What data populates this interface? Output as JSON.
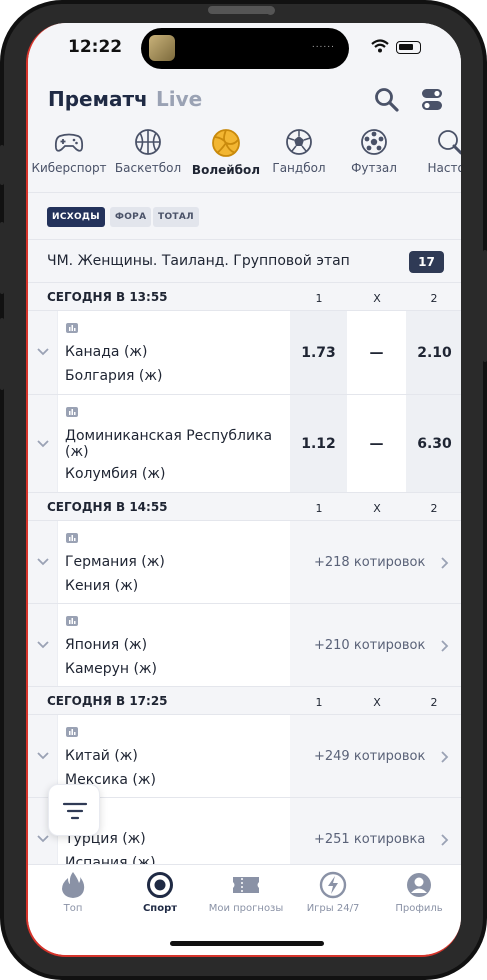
{
  "status_bar": {
    "time": "12:22",
    "island_dots": "......"
  },
  "header": {
    "tab_prematch": "Прематч",
    "tab_live": "Live"
  },
  "sports": [
    {
      "label": "Киберспорт",
      "icon": "gamepad-icon"
    },
    {
      "label": "Баскетбол",
      "icon": "basketball-icon"
    },
    {
      "label": "Волейбол",
      "icon": "volleyball-icon",
      "active": true
    },
    {
      "label": "Гандбол",
      "icon": "handball-icon"
    },
    {
      "label": "Футзал",
      "icon": "futsal-ball-icon"
    },
    {
      "label": "Настол",
      "icon": "table-tennis-icon"
    }
  ],
  "filters": [
    "ИСХОДЫ",
    "ФОРА",
    "ТОТАЛ"
  ],
  "tournament": {
    "title": "ЧМ. Женщины. Таиланд. Групповой этап",
    "count": "17"
  },
  "columns": {
    "c1": "1",
    "cx": "X",
    "c2": "2"
  },
  "groups": [
    {
      "date": "СЕГОДНЯ В 13:55",
      "events": [
        {
          "team1": "Канада (ж)",
          "team2": "Болгария (ж)",
          "odd1": "1.73",
          "oddx": "—",
          "odd2": "2.10"
        },
        {
          "team1": "Доминиканская Республика (ж)",
          "team2": "Колумбия (ж)",
          "odd1": "1.12",
          "oddx": "—",
          "odd2": "6.30"
        }
      ]
    },
    {
      "date": "СЕГОДНЯ В 14:55",
      "events": [
        {
          "team1": "Германия (ж)",
          "team2": "Кения (ж)",
          "quotes": "+218 котировок"
        },
        {
          "team1": "Япония (ж)",
          "team2": "Камерун (ж)",
          "quotes": "+210 котировок"
        }
      ]
    },
    {
      "date": "СЕГОДНЯ В 17:25",
      "events": [
        {
          "team1": "Китай (ж)",
          "team2": "Мексика (ж)",
          "quotes": "+249 котировок"
        },
        {
          "team1": "Турция (ж)",
          "team2": "Испания (ж)",
          "quotes": "+251 котировка"
        }
      ]
    }
  ],
  "bottom_nav": [
    {
      "label": "Топ",
      "icon": "flame-icon"
    },
    {
      "label": "Спорт",
      "icon": "sport-target-icon",
      "active": true
    },
    {
      "label": "Мои прогнозы",
      "icon": "ticket-icon"
    },
    {
      "label": "Игры 24/7",
      "icon": "lightning-icon"
    },
    {
      "label": "Профиль",
      "icon": "profile-icon"
    }
  ],
  "colors": {
    "accent": "#23325b",
    "volleyball": "#e8a317",
    "frame_edge": "#d6342b"
  }
}
